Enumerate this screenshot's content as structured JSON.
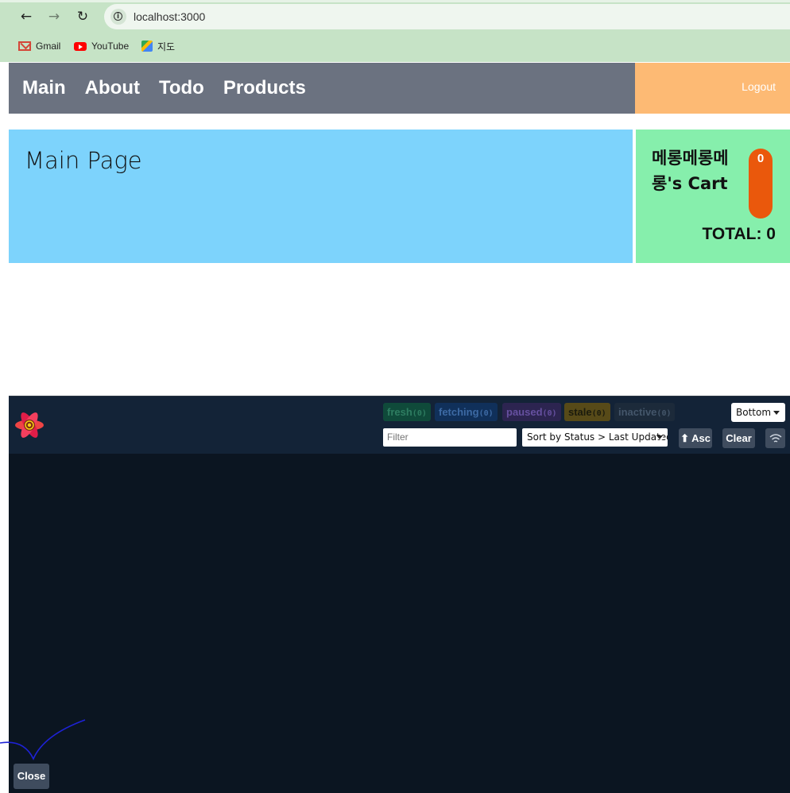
{
  "browser": {
    "url": "localhost:3000",
    "bookmarks": [
      {
        "label": "Gmail",
        "icon": "gmail-icon"
      },
      {
        "label": "YouTube",
        "icon": "youtube-icon"
      },
      {
        "label": "지도",
        "icon": "maps-icon"
      }
    ]
  },
  "header": {
    "nav": [
      "Main",
      "About",
      "Todo",
      "Products"
    ],
    "logout": "Logout",
    "colors": {
      "nav_bg": "#6b7280",
      "logout_bg": "#fdba74"
    }
  },
  "main": {
    "title": "Main Page",
    "bg": "#7dd3fc"
  },
  "cart": {
    "title": "메롱메롱메롱's Cart",
    "count": "0",
    "total": "TOTAL: 0",
    "bg": "#86efac",
    "count_bg": "#ea580c"
  },
  "devtools": {
    "badges": {
      "fresh": "fresh",
      "fresh_count": "(0)",
      "fetching": "fetching",
      "fetching_count": "(0)",
      "paused": "paused",
      "paused_count": "(0)",
      "stale": "stale",
      "stale_count": "(0)",
      "inactive": "inactive",
      "inactive_count": "(0)"
    },
    "position_select": "Bottom",
    "filter_placeholder": "Filter",
    "sort_select": "Sort by Status > Last Updated",
    "asc_label": "⬆ Asc",
    "clear_label": "Clear",
    "close_label": "Close"
  }
}
